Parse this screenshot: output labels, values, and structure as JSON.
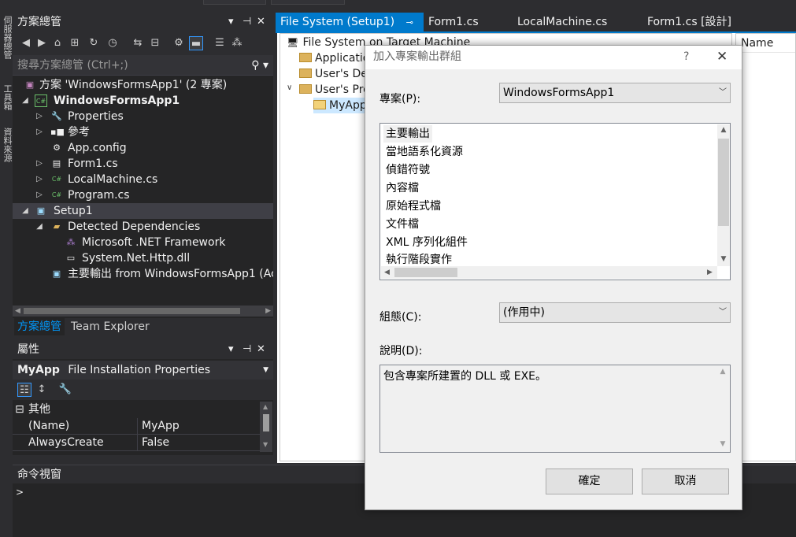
{
  "left_strip": {
    "tabs": [
      "伺服器總管",
      "工具箱",
      "資料來源"
    ]
  },
  "solution_explorer": {
    "title": "方案總管",
    "search_placeholder": "搜尋方案總管 (Ctrl+;)",
    "tree": [
      {
        "label": "方案 'WindowsFormsApp1' (2 專案)",
        "icon": "solution-icon"
      },
      {
        "label": "WindowsFormsApp1",
        "icon": "csharp-project-icon"
      },
      {
        "label": "Properties",
        "icon": "wrench-icon"
      },
      {
        "label": "參考",
        "icon": "references-icon"
      },
      {
        "label": "App.config",
        "icon": "config-file-icon"
      },
      {
        "label": "Form1.cs",
        "icon": "form-icon"
      },
      {
        "label": "LocalMachine.cs",
        "icon": "csharp-file-icon"
      },
      {
        "label": "Program.cs",
        "icon": "csharp-file-icon"
      },
      {
        "label": "Setup1",
        "icon": "setup-project-icon"
      },
      {
        "label": "Detected Dependencies",
        "icon": "folder-open-icon"
      },
      {
        "label": "Microsoft .NET Framework",
        "icon": "dependency-icon"
      },
      {
        "label": "System.Net.Http.dll",
        "icon": "assembly-icon"
      },
      {
        "label": "主要輸出 from WindowsFormsApp1 (Ac",
        "icon": "output-icon"
      }
    ],
    "tabs": [
      "方案總管",
      "Team Explorer"
    ]
  },
  "properties": {
    "title": "屬性",
    "object_name": "MyApp",
    "object_type": "File Installation Properties",
    "category": "其他",
    "rows": [
      {
        "key": "(Name)",
        "value": "MyApp"
      },
      {
        "key": "AlwaysCreate",
        "value": "False"
      }
    ]
  },
  "doc_tabs": [
    {
      "label": "File System (Setup1)",
      "active": true
    },
    {
      "label": "Form1.cs",
      "active": false
    },
    {
      "label": "LocalMachine.cs",
      "active": false
    },
    {
      "label": "Form1.cs [設計]",
      "active": false
    }
  ],
  "file_system": {
    "root": "File System on Target Machine",
    "items": [
      "Applicatio",
      "User's Des",
      "User's Pro",
      "MyApp"
    ],
    "name_header": "Name"
  },
  "command_window": {
    "title": "命令視窗",
    "prompt": ">"
  },
  "dialog": {
    "title": "加入專案輸出群組",
    "help": "?",
    "close": "✕",
    "project_label": "專案(P):",
    "project_value": "WindowsFormsApp1",
    "groups": [
      "主要輸出",
      "當地語系化資源",
      "偵錯符號",
      "內容檔",
      "原始程式檔",
      "文件檔",
      "XML 序列化組件",
      "執行階段實作"
    ],
    "config_label": "組態(C):",
    "config_value": "(作用中)",
    "desc_label": "說明(D):",
    "desc_text": "包含專案所建置的 DLL 或 EXE。",
    "ok": "確定",
    "cancel": "取消"
  }
}
